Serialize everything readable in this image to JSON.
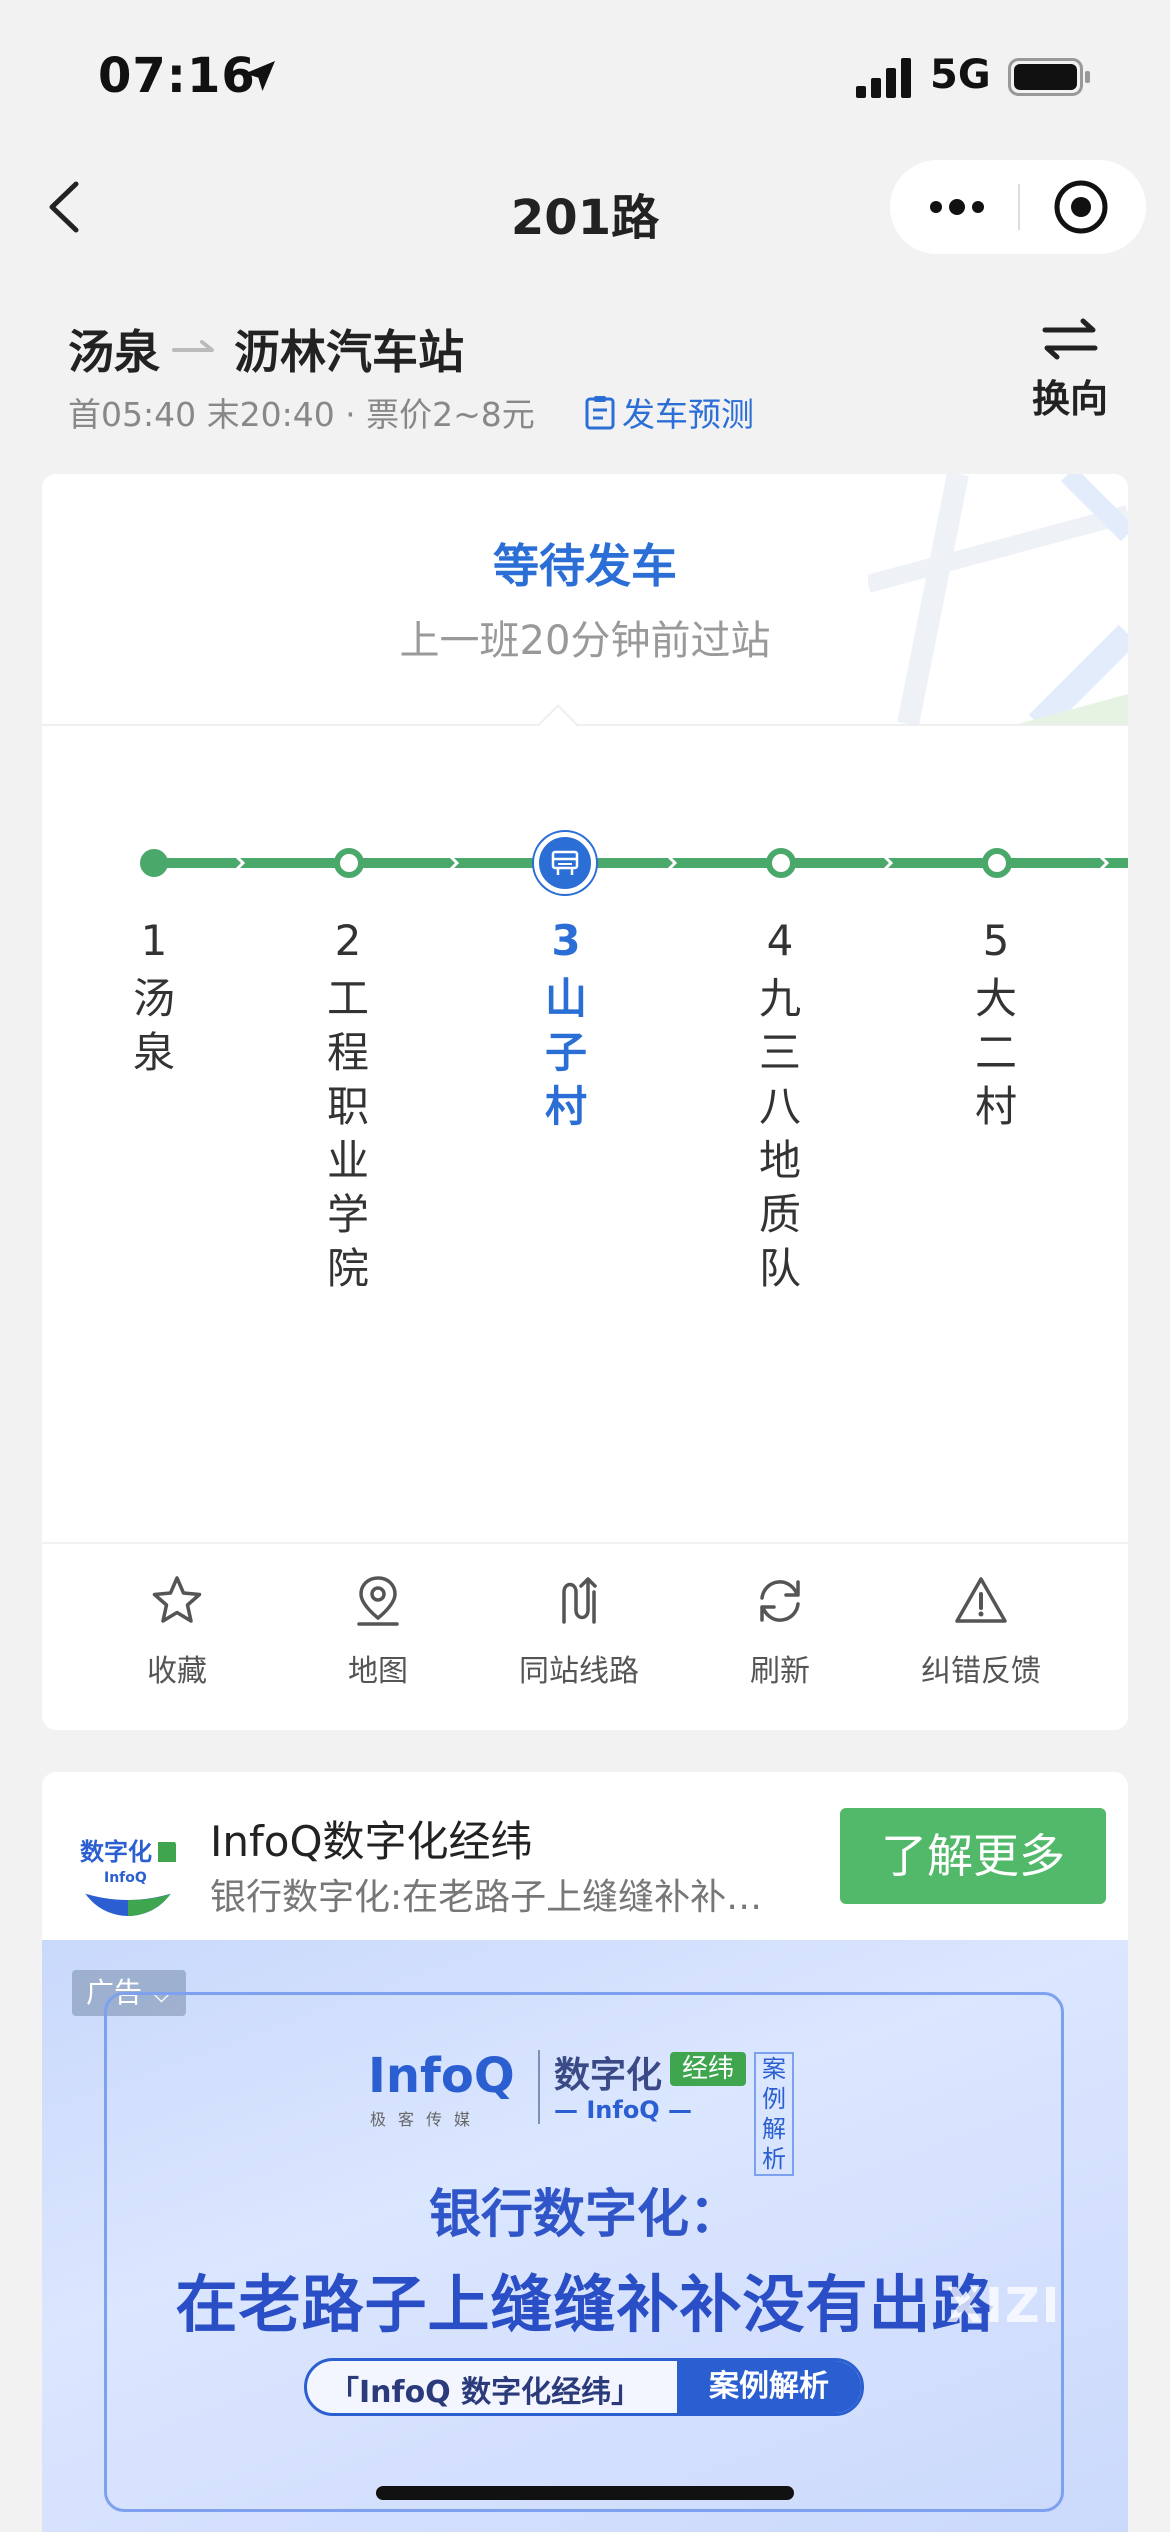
{
  "status_bar": {
    "time": "07:16",
    "network": "5G"
  },
  "nav": {
    "title": "201路"
  },
  "route": {
    "from": "汤泉",
    "to": "沥林汽车站",
    "meta": "首05:40 末20:40 · 票价2~8元",
    "forecast": "发车预测",
    "reverse": "换向"
  },
  "bus_status": {
    "main": "等待发车",
    "sub": "上一班20分钟前过站"
  },
  "stops": [
    {
      "num": "1",
      "name": "汤\n泉"
    },
    {
      "num": "2",
      "name": "工\n程\n职\n业\n学\n院"
    },
    {
      "num": "3",
      "name": "山\n子\n村"
    },
    {
      "num": "4",
      "name": "九\n三\n八\n地\n质\n队"
    },
    {
      "num": "5",
      "name": "大\n二\n村"
    }
  ],
  "current_stop_index": 2,
  "actions": [
    {
      "label": "收藏",
      "icon": "star-icon"
    },
    {
      "label": "地图",
      "icon": "map-pin-icon"
    },
    {
      "label": "同站线路",
      "icon": "route-icon"
    },
    {
      "label": "刷新",
      "icon": "refresh-icon"
    },
    {
      "label": "纠错反馈",
      "icon": "warning-icon"
    }
  ],
  "ad": {
    "logo_text": "数字化",
    "logo_sub": "InfoQ",
    "title": "InfoQ数字化经纬",
    "desc": "银行数字化:在老路子上缝缝补补没有出路",
    "button": "了解更多",
    "tag": "广告",
    "banner": {
      "brand": "InfoQ",
      "brand_sub": "极客传媒",
      "product": "数字化",
      "product_tag": "经纬",
      "product_sub": "— InfoQ —",
      "case": "案例解析",
      "headline1": "银行数字化：",
      "headline2": "在老路子上缝缝补补没有出路",
      "pill_left": "「InfoQ 数字化经纬」",
      "pill_right": "案例解析",
      "watermark": "XIZI"
    }
  },
  "colors": {
    "accent": "#2b6fd6",
    "line": "#4aa86a",
    "cta": "#52b96a"
  }
}
